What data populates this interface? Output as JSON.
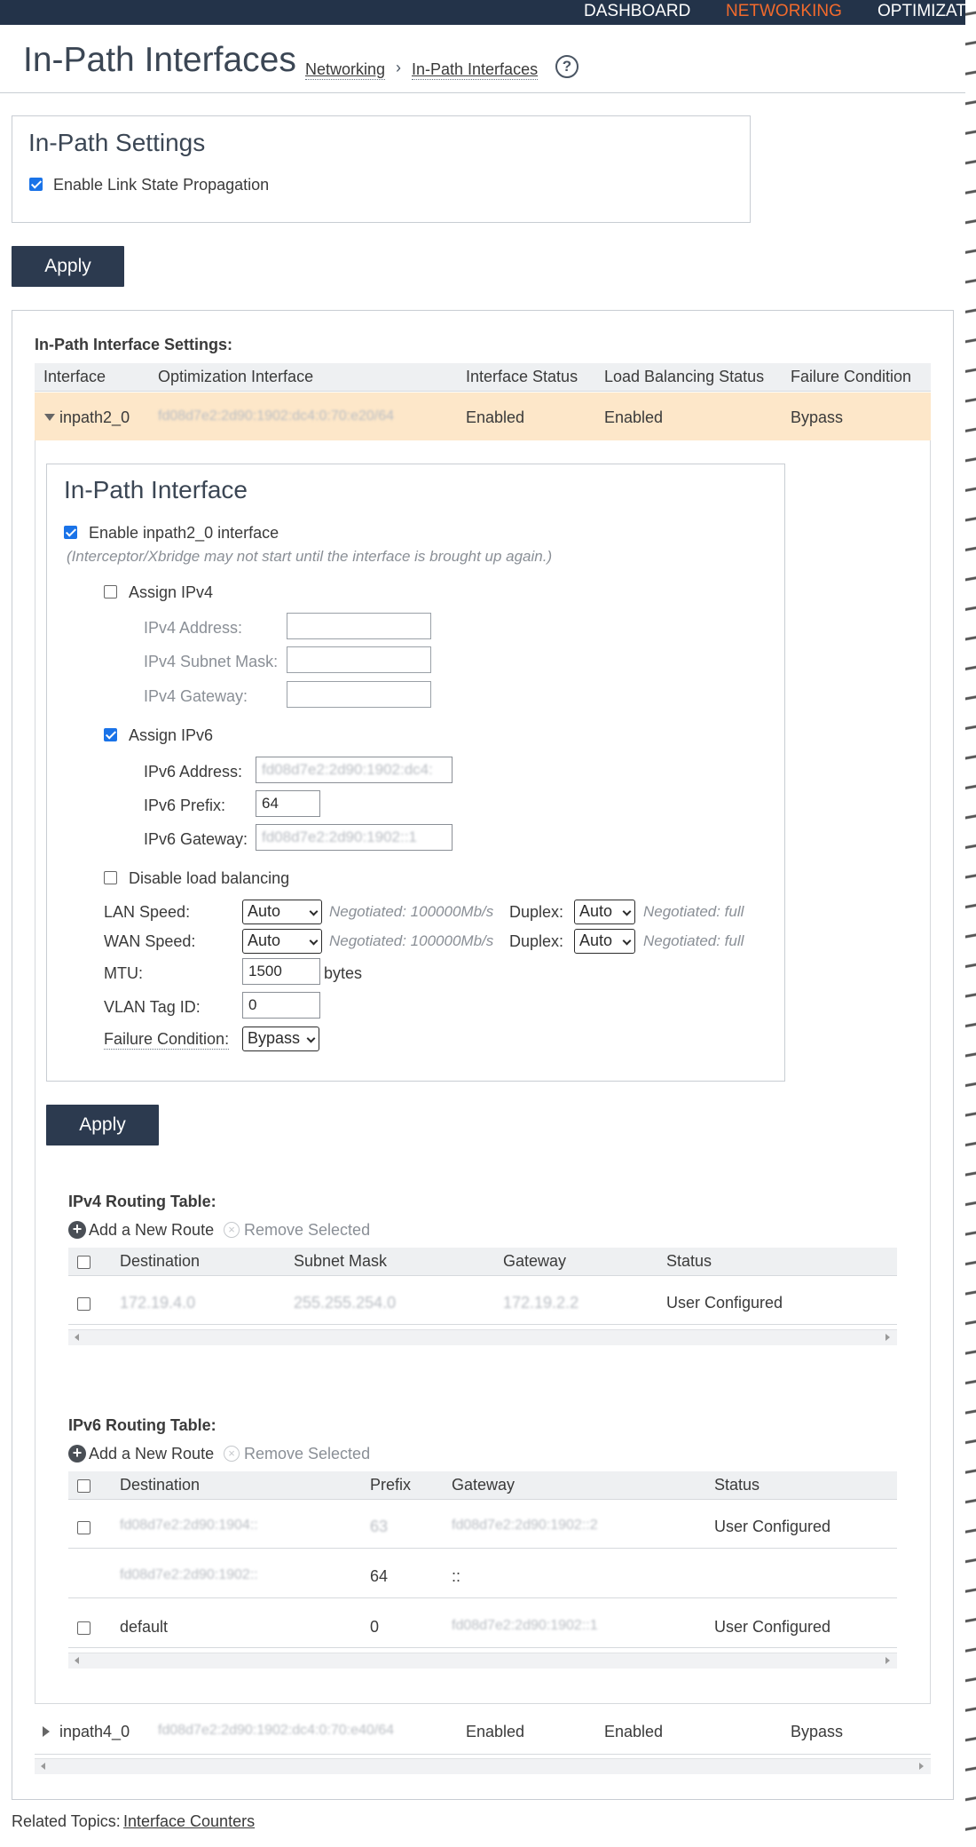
{
  "nav": {
    "dashboard": "DASHBOARD",
    "networking": "NETWORKING",
    "optimization": "OPTIMIZATI"
  },
  "header": {
    "title": "In-Path Interfaces",
    "crumb_parent": "Networking",
    "crumb_sep": "›",
    "crumb_current": "In-Path Interfaces",
    "help": "?"
  },
  "settings": {
    "title": "In-Path Settings",
    "lsp_label": "Enable Link State Propagation",
    "lsp_checked": true
  },
  "apply_label": "Apply",
  "iface_settings": {
    "title": "In-Path Interface Settings:",
    "columns": [
      "Interface",
      "Optimization Interface",
      "Interface Status",
      "Load Balancing Status",
      "Failure Condition"
    ],
    "rows": [
      {
        "interface": "inpath2_0",
        "opt": "fd08d7e2:2d90:1902:dc4:0:70:e20/64",
        "status": "Enabled",
        "lb": "Enabled",
        "failure": "Bypass",
        "expanded": true
      },
      {
        "interface": "inpath4_0",
        "opt": "fd08d7e2:2d90:1902:dc4:0:70:e40/64",
        "status": "Enabled",
        "lb": "Enabled",
        "failure": "Bypass",
        "expanded": false
      }
    ]
  },
  "inpath_iface": {
    "title": "In-Path Interface",
    "enable_label": "Enable inpath2_0 interface",
    "note": "(Interceptor/Xbridge may not start until the interface is brought up again.)",
    "assign_ipv4": "Assign IPv4",
    "ipv4_address": "IPv4 Address:",
    "ipv4_mask": "IPv4 Subnet Mask:",
    "ipv4_gateway": "IPv4 Gateway:",
    "assign_ipv6": "Assign IPv6",
    "ipv6_address": "IPv6 Address:",
    "ipv6_address_value": "fd08d7e2:2d90:1902:dc4:",
    "ipv6_prefix": "IPv6 Prefix:",
    "ipv6_prefix_value": "64",
    "ipv6_gateway": "IPv6 Gateway:",
    "ipv6_gateway_value": "fd08d7e2:2d90:1902::1",
    "disable_lb": "Disable load balancing",
    "lan_speed": "LAN Speed:",
    "wan_speed": "WAN Speed:",
    "speed_value": "Auto",
    "negotiated_speed": "Negotiated: 100000Mb/s",
    "duplex": "Duplex:",
    "duplex_value": "Auto",
    "negotiated_duplex": "Negotiated: full",
    "mtu": "MTU:",
    "mtu_value": "1500",
    "bytes": "bytes",
    "vlan": "VLAN Tag ID:",
    "vlan_value": "0",
    "failure": "Failure Condition:",
    "failure_value": "Bypass"
  },
  "ipv4_table": {
    "title": "IPv4 Routing Table:",
    "add": "Add a New Route",
    "remove": "Remove Selected",
    "columns": [
      "Destination",
      "Subnet Mask",
      "Gateway",
      "Status"
    ],
    "rows": [
      {
        "dest": "172.19.4.0",
        "mask": "255.255.254.0",
        "gw": "172.19.2.2",
        "status": "User Configured"
      }
    ]
  },
  "ipv6_table": {
    "title": "IPv6 Routing Table:",
    "add": "Add a New Route",
    "remove": "Remove Selected",
    "columns": [
      "Destination",
      "Prefix",
      "Gateway",
      "Status"
    ],
    "rows": [
      {
        "dest": "fd08d7e2:2d90:1904::",
        "prefix": "63",
        "gw": "fd08d7e2:2d90:1902::2",
        "status": "User Configured"
      },
      {
        "dest": "fd08d7e2:2d90:1902::",
        "prefix": "64",
        "gw": "::",
        "status": ""
      },
      {
        "dest": "default",
        "prefix": "0",
        "gw": "fd08d7e2:2d90:1902::1",
        "status": "User Configured"
      }
    ]
  },
  "related": {
    "label": "Related Topics:",
    "link": "Interface Counters"
  },
  "colors": {
    "nav_bg": "#233349",
    "nav_active": "#f26a2c",
    "selected_row": "#fde7c9",
    "button": "#2c3a4f"
  }
}
